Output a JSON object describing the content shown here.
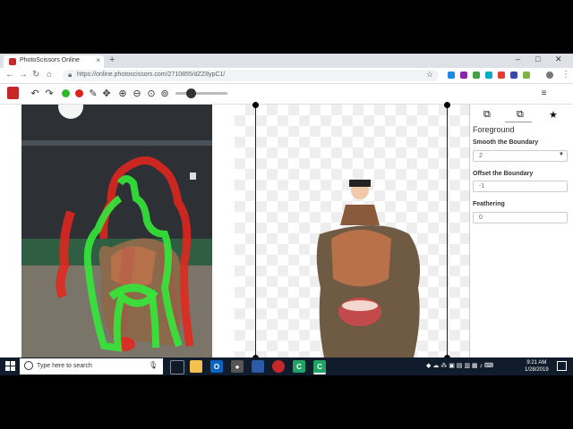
{
  "browser": {
    "tab_title": "PhotoScissors Online",
    "tab_close": "×",
    "new_tab": "+",
    "url": "https://online.photoscissors.com/2710855/dZZ8ypC1/",
    "window_controls": [
      "–",
      "□",
      "✕"
    ]
  },
  "app_toolbar": {
    "right_buttons": [
      {
        "icon": "help-icon",
        "glyph": "?",
        "color": "#f4a62a"
      },
      {
        "icon": "save-icon",
        "glyph": "▣",
        "color": "#2b7bd6"
      },
      {
        "icon": "menu-icon",
        "glyph": "≡",
        "color": "#ffffff"
      },
      {
        "icon": "close-icon",
        "glyph": "✕",
        "color": "#d9242b"
      }
    ]
  },
  "panel": {
    "tabs": [
      "⧉",
      "⧉",
      "★"
    ],
    "section_title": "Foreground",
    "smooth_label": "Smooth the Boundary",
    "smooth_value": "2",
    "offset_label": "Offset the Boundary",
    "offset_value": "-1",
    "feather_label": "Feathering",
    "feather_value": "0"
  },
  "taskbar": {
    "search_placeholder": "Type here to search",
    "time": "9:21 AM",
    "date": "1/28/2019"
  },
  "colors": {
    "foreground_mark": "#34e83a",
    "background_mark": "#e8251c",
    "taskbar": "#101c2b"
  }
}
